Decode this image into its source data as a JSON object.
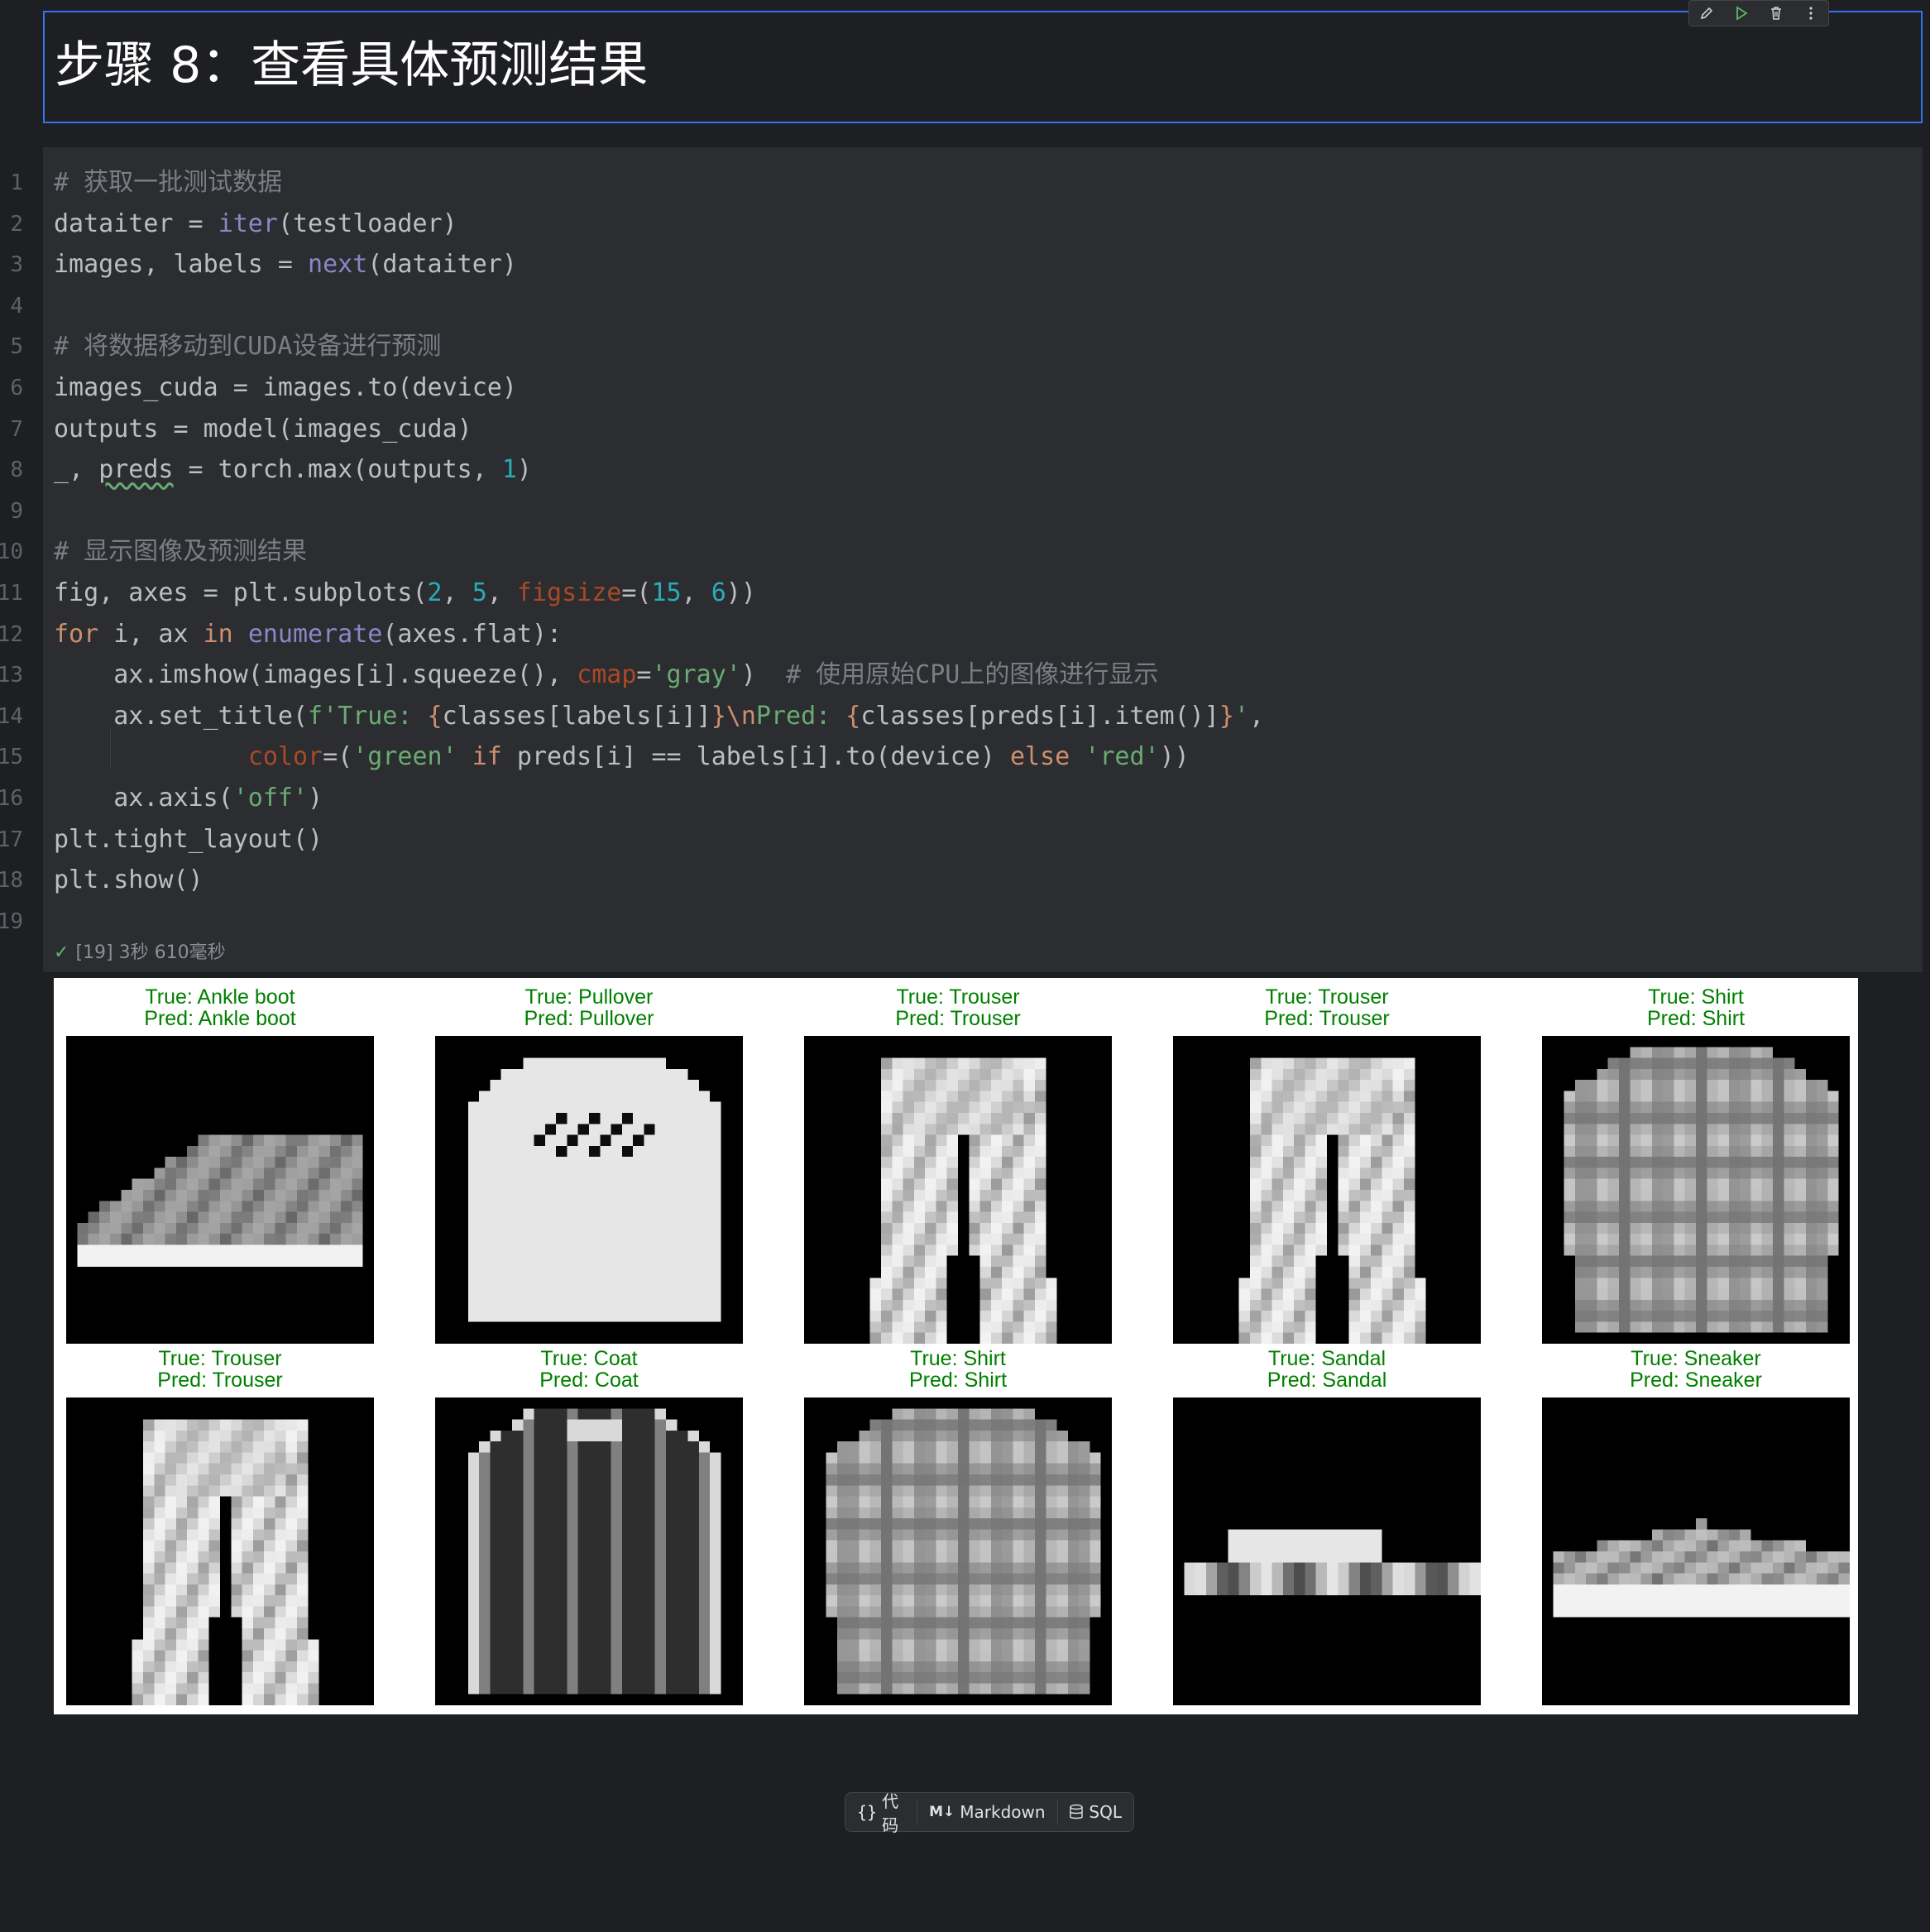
{
  "markdown_cell": {
    "title": "步骤 8：查看具体预测结果"
  },
  "toolbar": {
    "edit_icon": "pencil-icon",
    "run_icon": "play-icon",
    "delete_icon": "trash-icon",
    "more_icon": "more-vertical-icon"
  },
  "code_cell": {
    "line_numbers": [
      "1",
      "2",
      "3",
      "4",
      "5",
      "6",
      "7",
      "8",
      "9",
      "10",
      "11",
      "12",
      "13",
      "14",
      "15",
      "16",
      "17",
      "18",
      "19"
    ],
    "lines": [
      [
        [
          "cm",
          "# 获取一批测试数据"
        ]
      ],
      [
        [
          "t",
          "dataiter = "
        ],
        [
          "bi",
          "iter"
        ],
        [
          "t",
          "(testloader)"
        ]
      ],
      [
        [
          "t",
          "images, labels = "
        ],
        [
          "bi",
          "next"
        ],
        [
          "t",
          "(dataiter)"
        ]
      ],
      [],
      [
        [
          "cm",
          "# 将数据移动到CUDA设备进行预测"
        ]
      ],
      [
        [
          "t",
          "images_cuda = images.to(device)"
        ]
      ],
      [
        [
          "t",
          "outputs = model(images_cuda)"
        ]
      ],
      [
        [
          "t",
          "_, "
        ],
        [
          "wv",
          "preds"
        ],
        [
          "t",
          " = torch.max(outputs, "
        ],
        [
          "num",
          "1"
        ],
        [
          "t",
          ")"
        ]
      ],
      [],
      [
        [
          "cm",
          "# 显示图像及预测结果"
        ]
      ],
      [
        [
          "t",
          "fig, axes = plt.subplots("
        ],
        [
          "num",
          "2"
        ],
        [
          "t",
          ", "
        ],
        [
          "num",
          "5"
        ],
        [
          "t",
          ", "
        ],
        [
          "pr",
          "figsize"
        ],
        [
          "t",
          "=("
        ],
        [
          "num",
          "15"
        ],
        [
          "t",
          ", "
        ],
        [
          "num",
          "6"
        ],
        [
          "t",
          "))"
        ]
      ],
      [
        [
          "kw",
          "for"
        ],
        [
          "t",
          " i, ax "
        ],
        [
          "kw",
          "in"
        ],
        [
          "t",
          " "
        ],
        [
          "bi",
          "enumerate"
        ],
        [
          "t",
          "(axes.flat):"
        ]
      ],
      [
        [
          "t",
          "    ax.imshow(images[i].squeeze(), "
        ],
        [
          "pr",
          "cmap"
        ],
        [
          "t",
          "="
        ],
        [
          "st",
          "'gray'"
        ],
        [
          "t",
          ")  "
        ],
        [
          "cm",
          "# 使用原始CPU上的图像进行显示"
        ]
      ],
      [
        [
          "t",
          "    ax.set_title("
        ],
        [
          "st",
          "f'True: "
        ],
        [
          "br",
          "{"
        ],
        [
          "t",
          "classes[labels[i]]"
        ],
        [
          "br",
          "}"
        ],
        [
          "kw",
          "\\n"
        ],
        [
          "st",
          "Pred: "
        ],
        [
          "br",
          "{"
        ],
        [
          "t",
          "classes[preds[i].item()]"
        ],
        [
          "br",
          "}"
        ],
        [
          "st",
          "'"
        ],
        [
          "t",
          ","
        ]
      ],
      [
        [
          "t",
          "             "
        ],
        [
          "pr",
          "color"
        ],
        [
          "t",
          "=("
        ],
        [
          "st",
          "'green'"
        ],
        [
          "t",
          " "
        ],
        [
          "kw",
          "if"
        ],
        [
          "t",
          " preds[i] == labels[i].to(device) "
        ],
        [
          "kw",
          "else"
        ],
        [
          "t",
          " "
        ],
        [
          "st",
          "'red'"
        ],
        [
          "t",
          "))"
        ]
      ],
      [
        [
          "t",
          "    ax.axis("
        ],
        [
          "st",
          "'off'"
        ],
        [
          "t",
          ")"
        ]
      ],
      [
        [
          "t",
          "plt.tight_layout()"
        ]
      ],
      [
        [
          "t",
          "plt.show()"
        ]
      ],
      []
    ],
    "status": "[19] 3秒 610毫秒"
  },
  "colors": {
    "t": "#bcbec4",
    "cm": "#7a7e85",
    "bi": "#8888c6",
    "kw": "#cf8e6d",
    "st": "#6aab73",
    "num": "#2aacb8",
    "pr": "#aa4926",
    "br": "#cf8e6d",
    "wv": "#bcbec4"
  },
  "output": {
    "subplots": [
      {
        "true_label": "True: Ankle boot",
        "pred_label": "Pred: Ankle boot",
        "item": "ankle-boot"
      },
      {
        "true_label": "True: Pullover",
        "pred_label": "Pred: Pullover",
        "item": "pullover"
      },
      {
        "true_label": "True: Trouser",
        "pred_label": "Pred: Trouser",
        "item": "trouser"
      },
      {
        "true_label": "True: Trouser",
        "pred_label": "Pred: Trouser",
        "item": "trouser"
      },
      {
        "true_label": "True: Shirt",
        "pred_label": "Pred: Shirt",
        "item": "shirt"
      },
      {
        "true_label": "True: Trouser",
        "pred_label": "Pred: Trouser",
        "item": "trouser"
      },
      {
        "true_label": "True: Coat",
        "pred_label": "Pred: Coat",
        "item": "coat"
      },
      {
        "true_label": "True: Shirt",
        "pred_label": "Pred: Shirt",
        "item": "shirt"
      },
      {
        "true_label": "True: Sandal",
        "pred_label": "Pred: Sandal",
        "item": "sandal"
      },
      {
        "true_label": "True: Sneaker",
        "pred_label": "Pred: Sneaker",
        "item": "sneaker"
      }
    ]
  },
  "add_cell_bar": {
    "code_label": "代码",
    "markdown_label": "Markdown",
    "sql_label": "SQL"
  }
}
